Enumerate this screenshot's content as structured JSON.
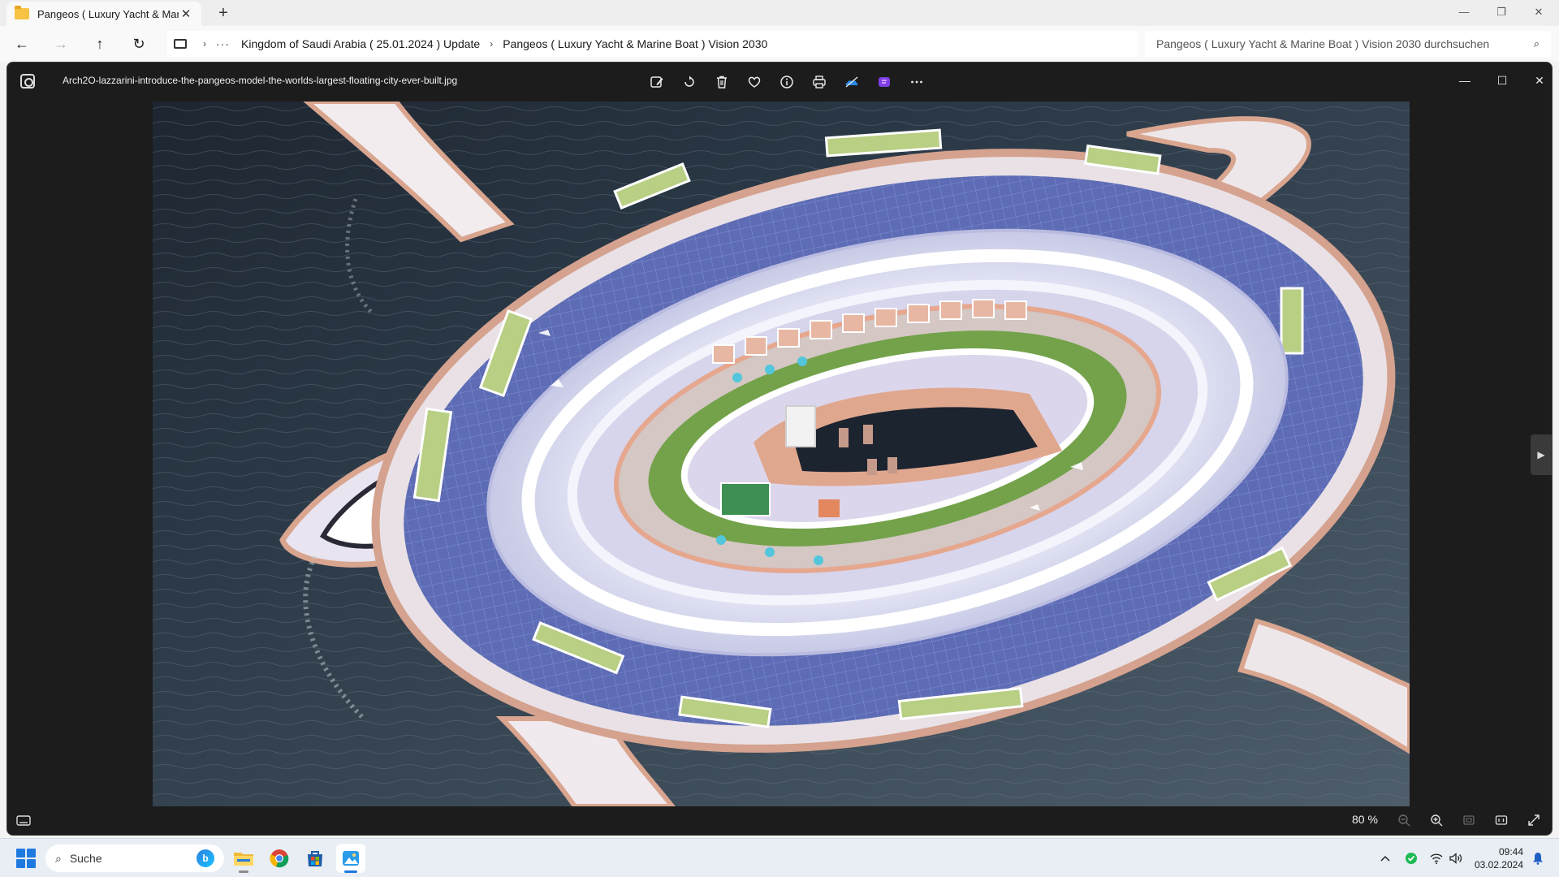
{
  "explorer": {
    "tab_title": "Pangeos ( Luxury Yacht & Mari",
    "new_tab_symbol": "+",
    "breadcrumb": {
      "overflow": "···",
      "crumbs": [
        "Kingdom of Saudi Arabia ( 25.01.2024 ) Update",
        "Pangeos ( Luxury Yacht & Marine Boat ) Vision 2030"
      ]
    },
    "search_placeholder": "Pangeos ( Luxury Yacht & Marine Boat ) Vision 2030 durchsuchen"
  },
  "viewer": {
    "file_name": "Arch2O-lazzarini-introduce-the-pangeos-model-the-worlds-largest-floating-city-ever-built.jpg",
    "toolbar_icons": [
      "edit-image-icon",
      "rotate-icon",
      "delete-icon",
      "favorite-heart-icon",
      "info-icon",
      "print-icon",
      "onedrive-icon",
      "clipchamp-icon",
      "more-options-icon"
    ],
    "zoom_level": "80 %",
    "image_subject": "Pangeos floating city"
  },
  "taskbar": {
    "search_label": "Suche",
    "time": "09:44",
    "date": "03.02.2024",
    "apps": [
      "file-explorer",
      "chrome",
      "microsoft-store",
      "photos"
    ]
  },
  "colors": {
    "accent": "#1f7ae0",
    "viewer_bg": "#1c1c1c",
    "taskbar_bg": "#e9eef5"
  }
}
